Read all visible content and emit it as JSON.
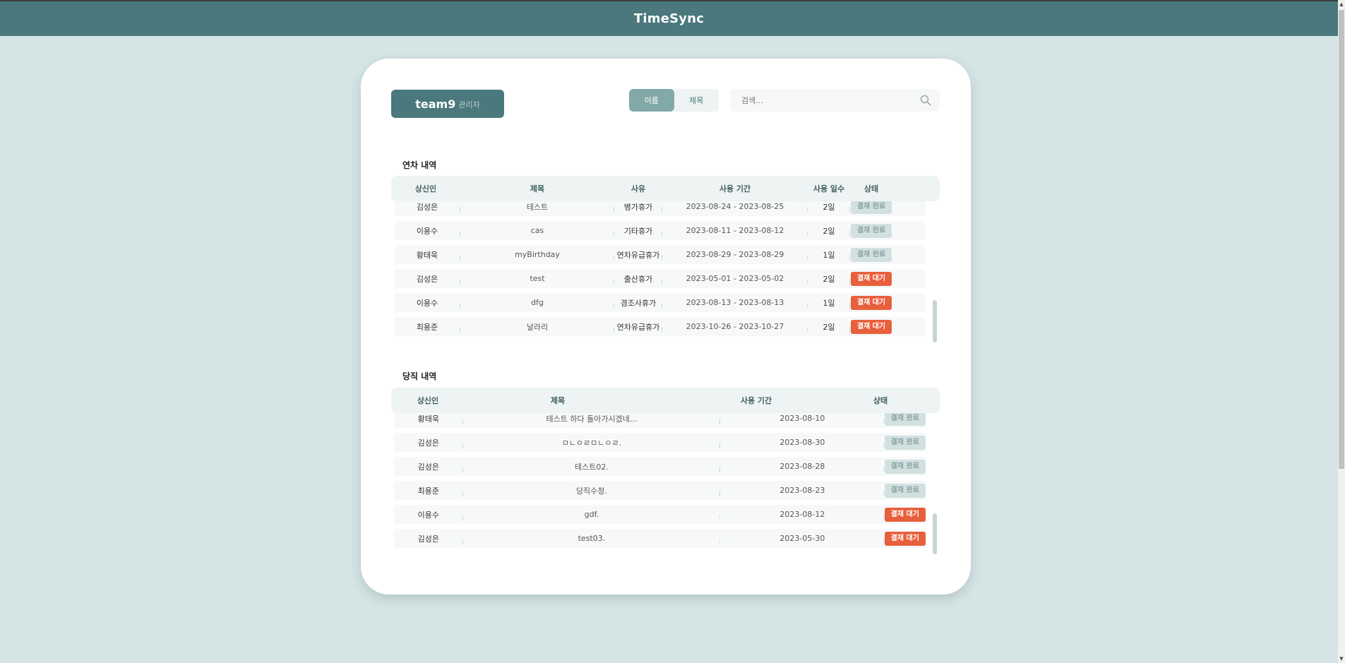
{
  "app": {
    "title": "TimeSync"
  },
  "team": {
    "name": "team9",
    "role": "관리자"
  },
  "search": {
    "toggle_options": [
      "이름",
      "제목"
    ],
    "active_option": "이름",
    "placeholder": "검색..."
  },
  "leave": {
    "title": "연차 내역",
    "columns": [
      "상신인",
      "제목",
      "사유",
      "사용 기간",
      "사용 일수",
      "상태"
    ],
    "rows": [
      {
        "author": "김성은",
        "title": "테스트",
        "reason": "병가휴가",
        "period": "2023-08-24 - 2023-08-25",
        "days": "2일",
        "status": "결재 완료",
        "status_type": "done"
      },
      {
        "author": "이용수",
        "title": "cas",
        "reason": "기타휴가",
        "period": "2023-08-11 - 2023-08-12",
        "days": "2일",
        "status": "결재 완료",
        "status_type": "done"
      },
      {
        "author": "황태욱",
        "title": "myBirthday",
        "reason": "연차유급휴가",
        "period": "2023-08-29 - 2023-08-29",
        "days": "1일",
        "status": "결재 완료",
        "status_type": "done"
      },
      {
        "author": "김성은",
        "title": "test",
        "reason": "출산휴가",
        "period": "2023-05-01 - 2023-05-02",
        "days": "2일",
        "status": "결재 대기",
        "status_type": "wait"
      },
      {
        "author": "이용수",
        "title": "dfg",
        "reason": "경조사휴가",
        "period": "2023-08-13 - 2023-08-13",
        "days": "1일",
        "status": "결재 대기",
        "status_type": "wait"
      },
      {
        "author": "최용준",
        "title": "날라리",
        "reason": "연차유급휴가",
        "period": "2023-10-26 - 2023-10-27",
        "days": "2일",
        "status": "결재 대기",
        "status_type": "wait"
      }
    ]
  },
  "duty": {
    "title": "당직 내역",
    "columns": [
      "상신인",
      "제목",
      "사용 기간",
      "상태"
    ],
    "rows": [
      {
        "author": "황태욱",
        "title": "테스트 하다 돌아가시겠네...",
        "date": "2023-08-10",
        "status": "결재 완료",
        "status_type": "done"
      },
      {
        "author": "김성은",
        "title": "ㅁㄴㅇㄹㅁㄴㅇㄹ.",
        "date": "2023-08-30",
        "status": "결재 완료",
        "status_type": "done"
      },
      {
        "author": "김성은",
        "title": "테스트02.",
        "date": "2023-08-28",
        "status": "결재 완료",
        "status_type": "done"
      },
      {
        "author": "최용준",
        "title": "당직수정.",
        "date": "2023-08-23",
        "status": "결재 완료",
        "status_type": "done"
      },
      {
        "author": "이용수",
        "title": "gdf.",
        "date": "2023-08-12",
        "status": "결재 대기",
        "status_type": "wait"
      },
      {
        "author": "김성은",
        "title": "test03.",
        "date": "2023-05-30",
        "status": "결재 대기",
        "status_type": "wait"
      }
    ]
  },
  "colors": {
    "header_bg": "#4a787c",
    "page_bg": "#d5e4e4",
    "badge_done": "#d2e0e0",
    "badge_wait": "#e85f3c"
  }
}
